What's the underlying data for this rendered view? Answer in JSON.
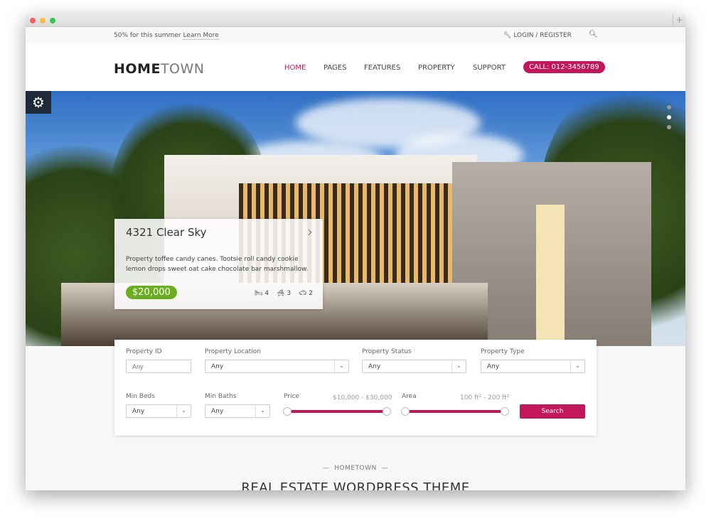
{
  "colors": {
    "accent": "#c2185b",
    "price": "#6aad1f"
  },
  "topbar": {
    "promo_text": "50% for this summer",
    "promo_link": "Learn More",
    "login": "LOGIN / REGISTER",
    "login_icon": "wrench-icon",
    "search_icon": "search-icon"
  },
  "header": {
    "logo_bold": "HOME",
    "logo_light": "TOWN",
    "nav": [
      {
        "label": "HOME",
        "active": true
      },
      {
        "label": "PAGES"
      },
      {
        "label": "FEATURES"
      },
      {
        "label": "PROPERTY"
      },
      {
        "label": "SUPPORT"
      }
    ],
    "call": "CALL: 012-3456789"
  },
  "hero": {
    "slides": 3,
    "active_slide": 2,
    "card": {
      "title": "4321 Clear Sky",
      "description": "Property toffee candy canes. Tootsie roll candy cookie lemon drops sweet oat cake chocolate bar marshmallow.",
      "price": "$20,000",
      "beds": "4",
      "baths": "3",
      "garages": "2"
    }
  },
  "search": {
    "property_id": {
      "label": "Property ID",
      "placeholder": "Any"
    },
    "location": {
      "label": "Property Location",
      "value": "Any"
    },
    "status": {
      "label": "Property Status",
      "value": "Any"
    },
    "type": {
      "label": "Property Type",
      "value": "Any"
    },
    "min_beds": {
      "label": "Min Beds",
      "value": "Any"
    },
    "min_baths": {
      "label": "Min Baths",
      "value": "Any"
    },
    "price": {
      "label": "Price",
      "range": "$10,000 - $30,000"
    },
    "area": {
      "label": "Area",
      "range": "100 ft² - 200 ft²"
    },
    "button": "Search"
  },
  "section": {
    "label": "HOMETOWN",
    "title": "REAL ESTATE WORDPRESS THEME"
  }
}
